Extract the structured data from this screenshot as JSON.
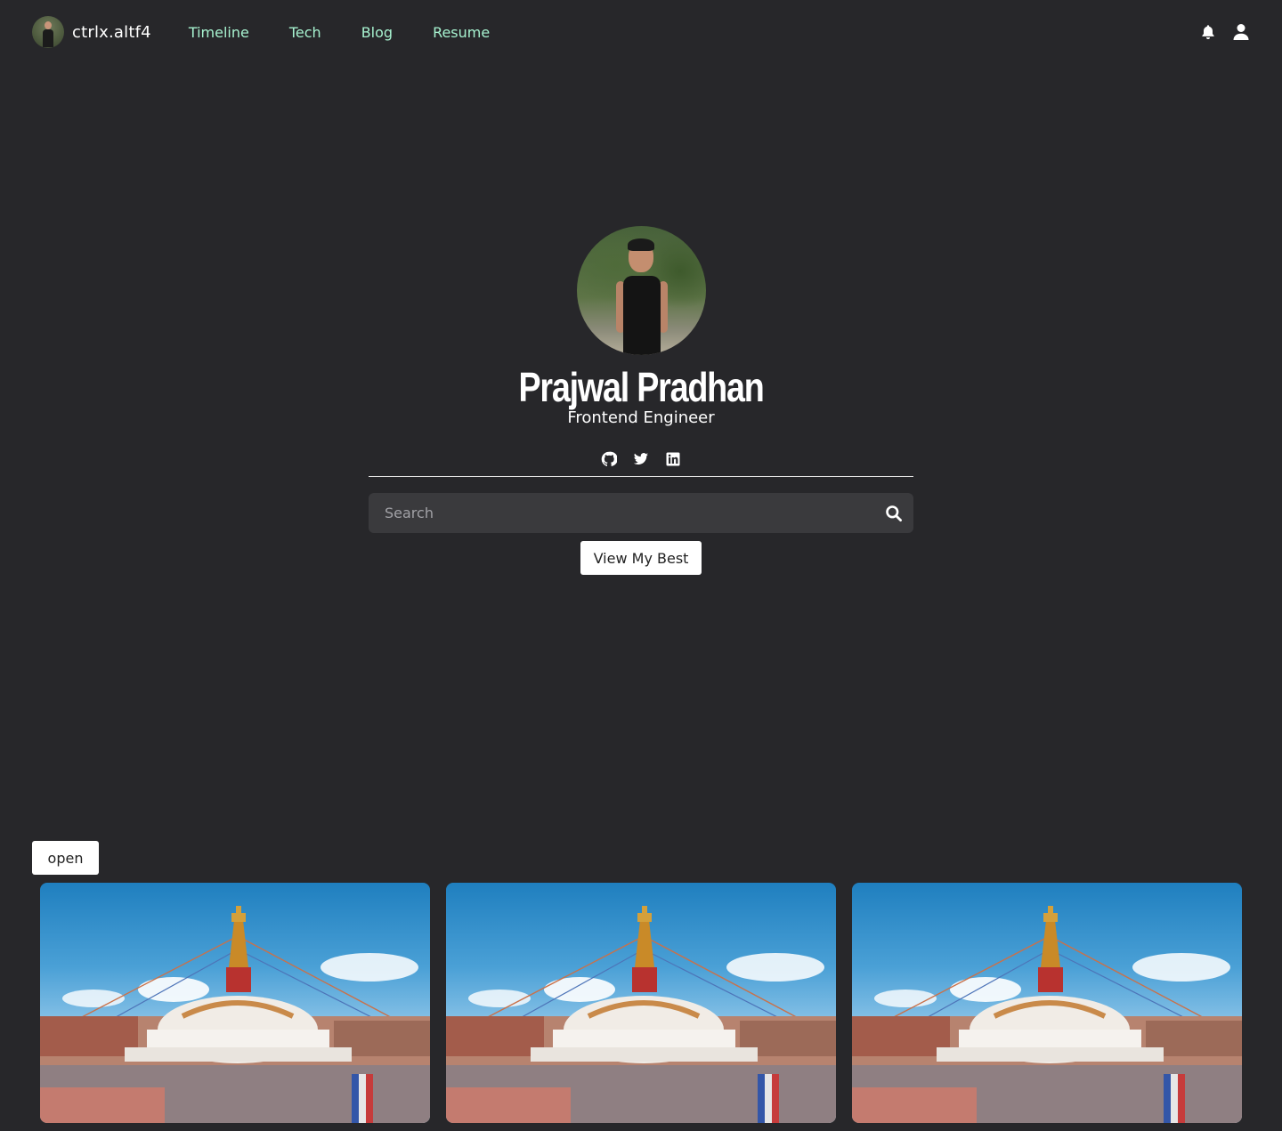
{
  "navbar": {
    "brand_name": "ctrlx.altf4",
    "links": [
      {
        "label": "Timeline"
      },
      {
        "label": "Tech"
      },
      {
        "label": "Blog"
      },
      {
        "label": "Resume"
      }
    ],
    "icons": [
      "bell-icon",
      "user-icon"
    ],
    "link_color": "#a7f3d0"
  },
  "hero": {
    "name": "Prajwal Pradhan",
    "role": "Frontend Engineer",
    "social_icons": [
      "github-icon",
      "twitter-icon",
      "linkedin-icon"
    ]
  },
  "search": {
    "placeholder": "Search",
    "value": ""
  },
  "buttons": {
    "view_best": "View My Best",
    "open": "open"
  },
  "gallery": {
    "items": [
      {
        "alt": "Boudhanath stupa"
      },
      {
        "alt": "Boudhanath stupa"
      },
      {
        "alt": "Boudhanath stupa"
      }
    ]
  },
  "colors": {
    "background": "#27272a",
    "search_bg": "#3a3a3d"
  }
}
